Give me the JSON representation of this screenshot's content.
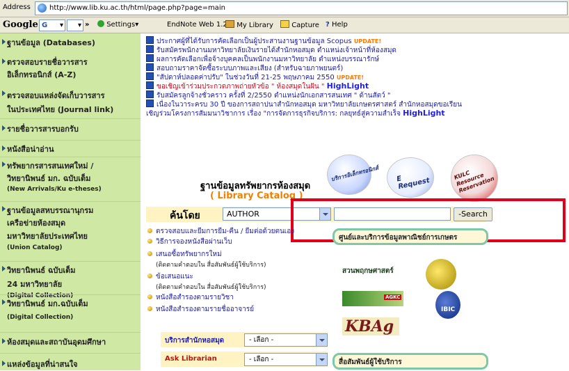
{
  "address": {
    "label": "Address",
    "url": "http://www.lib.ku.ac.th/html/page.php?page=main"
  },
  "toolbar": {
    "google_label": "Google",
    "google_select": "G",
    "more": "»",
    "settings": "Settings",
    "endnote": "EndNote Web 1.2",
    "mylibrary": "My Library",
    "capture": "Capture",
    "help": "Help"
  },
  "sidebar": {
    "items": [
      {
        "label": "ฐานข้อมูล (Databases)"
      },
      {
        "label": "ตรวจสอบรายชื่อวารสาร",
        "label2": "อิเล็กทรอนิกส์ (A-Z)"
      },
      {
        "label": "ตรวจสอบแหล่งจัดเก็บวารสาร",
        "label2": "ในประเทศไทย (Journal link)"
      },
      {
        "label": "รายชื่อวารสารบอกรับ"
      },
      {
        "label": "หนังสือน่าอ่าน"
      },
      {
        "label": "ทรัพยากรสารสนเทศใหม่ /",
        "label2": "วิทยานิพนธ์ มก. ฉบับเต็ม",
        "label3": "(New Arrivals/Ku e-theses)"
      },
      {
        "label": "ฐานข้อมูลสหบรรณานุกรม",
        "label2": "เครือข่ายห้องสมุด",
        "label3": "มหาวิทยาลัยประเทศไทย",
        "label4": "(Union Catalog)"
      },
      {
        "label": "วิทยานิพนธ์ ฉบับเต็ม",
        "label2": "24 มหาวิทยาลัย",
        "label3": "(Digital Collection)"
      },
      {
        "label": "วิทยานิพนธ์ มก.ฉบับเต็ม",
        "label2": "(Digital Collection)"
      },
      {
        "label": "ห้องสมุดและสถาบันอุดมศึกษา"
      },
      {
        "label": "แหล่งข้อมูลที่น่าสนใจ"
      }
    ]
  },
  "news": [
    {
      "text": "ประกาศผู้ที่ได้รับการคัดเลือกเป็นผู้ประสานงานฐานข้อมูล Scopus",
      "badge": "UPDATE!"
    },
    {
      "text": "รับสมัครพนักงานมหาวิทยาลัยเงินรายได้สำนักหอสมุด ตำแหน่งเจ้าหน้าที่ห้องสมุด"
    },
    {
      "text": "ผลการคัดเลือกเพื่อจ้างบุคคลเป็นพนักงานมหาวิทยาลัย ตำแหน่งบรรณารักษ์"
    },
    {
      "text": "สอบถามราคาจัดซื้อระบบภาพและเสียง (สำหรับฉายภาพยนตร์)"
    },
    {
      "text": "\"สัปดาห์ปลอดค่าปรับ\" ในช่วงวันที่ 21-25 พฤษภาคม 2550",
      "badge": "UPDATE!"
    },
    {
      "text": "ขอเชิญเข้าร่วมประกวดภาพถ่ายหัวข้อ \" ห้องสมุดในฝัน \"",
      "hl": "HighLight"
    },
    {
      "text": "รับสมัครลูกจ้างชั่วคราว ครั้งที่ 2/2550 ตำแหน่งนักเอกสารสนเทศ \" ด้านสัตว์ \""
    },
    {
      "text": "เนื่องในวาระครบ 30 ปี ของการสถาปนาสำนักหอสมุด มหาวิทยาลัยเกษตรศาสตร์ สำนักหอสมุดขอเรียน"
    },
    {
      "text": "เชิญร่วมโครงการสัมมนาวิชาการ เรื่อง \"การจัดการธุรกิจบริการ: กลยุทธ์สู่ความสำเร็จ",
      "hl": "HighLight"
    }
  ],
  "catalog": {
    "title": "ฐานข้อมูลทรัพยากรห้องสมุด",
    "subtitle": "( Library Catalog )",
    "logo1": "บริการอิเล็กทรอนิกส์",
    "logo2": "E Request",
    "logo3": "KULC Resource Reservation"
  },
  "search": {
    "label": "ค้นโดย",
    "field": "AUTHOR",
    "button": "-Search"
  },
  "menu": [
    {
      "text": "ตรวจสอบและยืมการยืม-คืน / ยืมต่อด้วยตนเอง"
    },
    {
      "text": "วิธีการจองหนังสือผ่านเว็บ"
    },
    {
      "text": "เสนอซื้อทรัพยากรใหม่",
      "sub": "(ติดตามคำตอบใน สื่อสัมพันธ์ผู้ใช้บริการ)"
    },
    {
      "text": "ข้อเสนอแนะ",
      "sub": "(ติดตามคำตอบใน สื่อสัมพันธ์ผู้ใช้บริการ)"
    },
    {
      "text": "หนังสือสำรองตามรายวิชา"
    },
    {
      "text": "หนังสือสำรองตามรายชื่ออาจารย์"
    }
  ],
  "pill_top": "ศูนย์และบริการข้อมูลพาณิชย์การเกษตร",
  "pill_bottom": "สื่อสัมพันธ์ผู้ใช้บริการ",
  "logos": {
    "garden": "สวนพฤกษศาสตร์",
    "agkc": "AGKC",
    "kbag": "KBAg",
    "ibic": "IBIC"
  },
  "services": [
    {
      "label": "บริการสำนักหอสมุด",
      "value": "- เลือก -"
    },
    {
      "label": "Ask Librarian",
      "value": "- เลือก -"
    }
  ]
}
